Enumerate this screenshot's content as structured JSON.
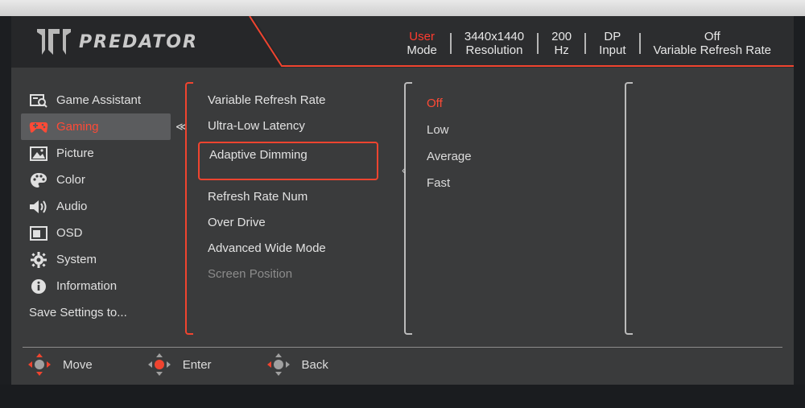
{
  "brand": {
    "logo_text": "PREDATOR"
  },
  "status": [
    {
      "top": "User",
      "bottom": "Mode",
      "top_red": true
    },
    {
      "top": "3440x1440",
      "bottom": "Resolution",
      "top_red": false
    },
    {
      "top": "200",
      "bottom": "Hz",
      "top_red": false
    },
    {
      "top": "DP",
      "bottom": "Input",
      "top_red": false
    },
    {
      "top": "Off",
      "bottom": "Variable Refresh Rate",
      "top_red": false
    }
  ],
  "sidebar": {
    "items": [
      {
        "label": "Game Assistant",
        "icon": "game-assistant-icon"
      },
      {
        "label": "Gaming",
        "icon": "gamepad-icon"
      },
      {
        "label": "Picture",
        "icon": "picture-icon"
      },
      {
        "label": "Color",
        "icon": "palette-icon"
      },
      {
        "label": "Audio",
        "icon": "speaker-icon"
      },
      {
        "label": "OSD",
        "icon": "osd-icon"
      },
      {
        "label": "System",
        "icon": "gear-icon"
      },
      {
        "label": "Information",
        "icon": "info-icon"
      }
    ],
    "save_label": "Save Settings to...",
    "active_index": 1
  },
  "submenu": {
    "items": [
      "Variable Refresh Rate",
      "Ultra-Low Latency",
      "Adaptive Dimming",
      "Refresh Rate Num",
      "Over Drive",
      "Advanced Wide Mode",
      "Screen Position"
    ],
    "selected_index": 2,
    "disabled_index": 6
  },
  "options": {
    "items": [
      "Off",
      "Low",
      "Average",
      "Fast"
    ],
    "current_index": 0
  },
  "footer": {
    "move": "Move",
    "enter": "Enter",
    "back": "Back"
  },
  "colors": {
    "accent": "#f0442f",
    "panel": "#3a3b3c",
    "header": "#262729"
  }
}
